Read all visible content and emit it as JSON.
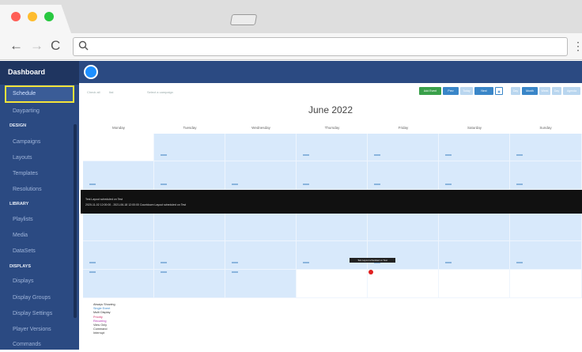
{
  "browser": {
    "menu_glyph": "⋮",
    "back_glyph": "←",
    "forward_glyph": "→",
    "reload_glyph": "C"
  },
  "sidebar": {
    "title": "Dashboard",
    "items": [
      {
        "label": "Schedule"
      },
      {
        "label": "Dayparting"
      },
      {
        "section": "DESIGN"
      },
      {
        "label": "Campaigns"
      },
      {
        "label": "Layouts"
      },
      {
        "label": "Templates"
      },
      {
        "label": "Resolutions"
      },
      {
        "section": "LIBRARY"
      },
      {
        "label": "Playlists"
      },
      {
        "label": "Media"
      },
      {
        "label": "DataSets"
      },
      {
        "section": "DISPLAYS"
      },
      {
        "label": "Displays"
      },
      {
        "label": "Display Groups"
      },
      {
        "label": "Display Settings"
      },
      {
        "label": "Player Versions"
      },
      {
        "label": "Commands"
      }
    ]
  },
  "toolbar": {
    "filters": [
      "Check all",
      "Ital",
      "Select a campaign"
    ],
    "buttons": [
      {
        "label": "Add Event",
        "color": "#3aa04a"
      },
      {
        "label": "Prev",
        "color": "#3a86c8"
      },
      {
        "label": "Today",
        "color": "#b9d6ef"
      },
      {
        "label": "Next",
        "color": "#3a86c8"
      },
      {
        "label": "▣",
        "color": "#ffffff"
      },
      {
        "label": "Day",
        "color": "#b9d6ef"
      },
      {
        "label": "Month",
        "color": "#3a86c8"
      },
      {
        "label": "Week",
        "color": "#b9d6ef"
      },
      {
        "label": "Day",
        "color": "#b9d6ef"
      },
      {
        "label": "Agenda",
        "color": "#b9d6ef"
      }
    ]
  },
  "calendar": {
    "month_title": "June 2022",
    "days_of_week": [
      "Monday",
      "Tuesday",
      "Wednesday",
      "Thursday",
      "Friday",
      "Saturday",
      "Sunday"
    ],
    "highlight_color": "#d8e9fb"
  },
  "popover": {
    "line1": "Test Layout scheduled on Test",
    "line2": "2020-11-02 12:00:00 - 2021-06-18 12:00:00 Countdown Layout scheduled on Test"
  },
  "tooltip": {
    "text": "Test Layout scheduled on Test"
  },
  "legend": {
    "items": [
      {
        "label": "Always Showing",
        "color": "#333"
      },
      {
        "label": "Single Event",
        "color": "#3a86c8"
      },
      {
        "label": "Multi Display",
        "color": "#333"
      },
      {
        "label": "Priority",
        "color": "#d0306a"
      },
      {
        "label": "Recurring",
        "color": "#b030b0"
      },
      {
        "label": "View Only",
        "color": "#333"
      },
      {
        "label": "Command",
        "color": "#333"
      },
      {
        "label": "Interrupt",
        "color": "#333"
      }
    ]
  }
}
